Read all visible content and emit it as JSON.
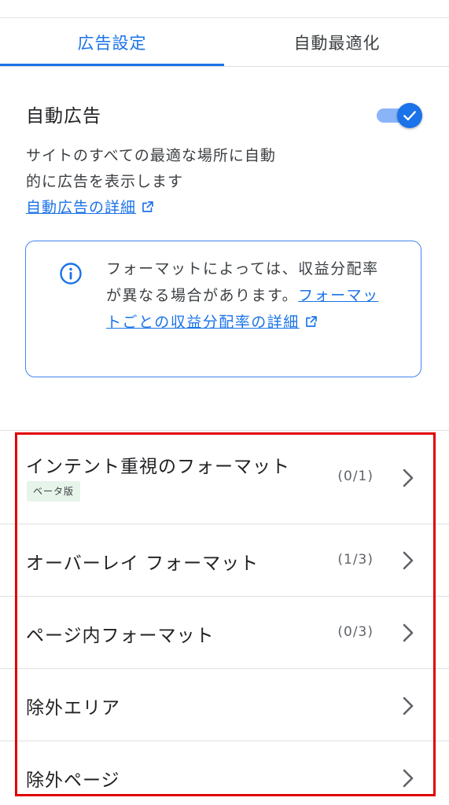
{
  "tabs": [
    {
      "label": "広告設定",
      "active": true
    },
    {
      "label": "自動最適化",
      "active": false
    }
  ],
  "auto_ads": {
    "title": "自動広告",
    "toggle_on": true,
    "description_line1": "サイトのすべての最適な場所に自動",
    "description_line2": "的に広告を表示します",
    "learn_more": "自動広告の詳細"
  },
  "info": {
    "text": "フォーマットによっては、収益分配率が異なる場合があります。",
    "link": "フォーマットごとの収益分配率の詳細"
  },
  "formats": [
    {
      "label": "インテント重視のフォーマット",
      "count": "(0/1)",
      "badge": "ベータ版"
    },
    {
      "label": "オーバーレイ フォーマット",
      "count": "(1/3)"
    },
    {
      "label": "ページ内フォーマット",
      "count": "(0/3)"
    },
    {
      "label": "除外エリア",
      "count": ""
    },
    {
      "label": "除外ページ",
      "count": ""
    }
  ],
  "colors": {
    "accent": "#1a73e8",
    "highlight_frame": "#e00000",
    "beta_badge_bg": "#e6f4ea"
  },
  "icons": {
    "toggle": "check-icon",
    "link": "external-link-icon",
    "info": "info-icon",
    "row": "chevron-right-icon"
  }
}
